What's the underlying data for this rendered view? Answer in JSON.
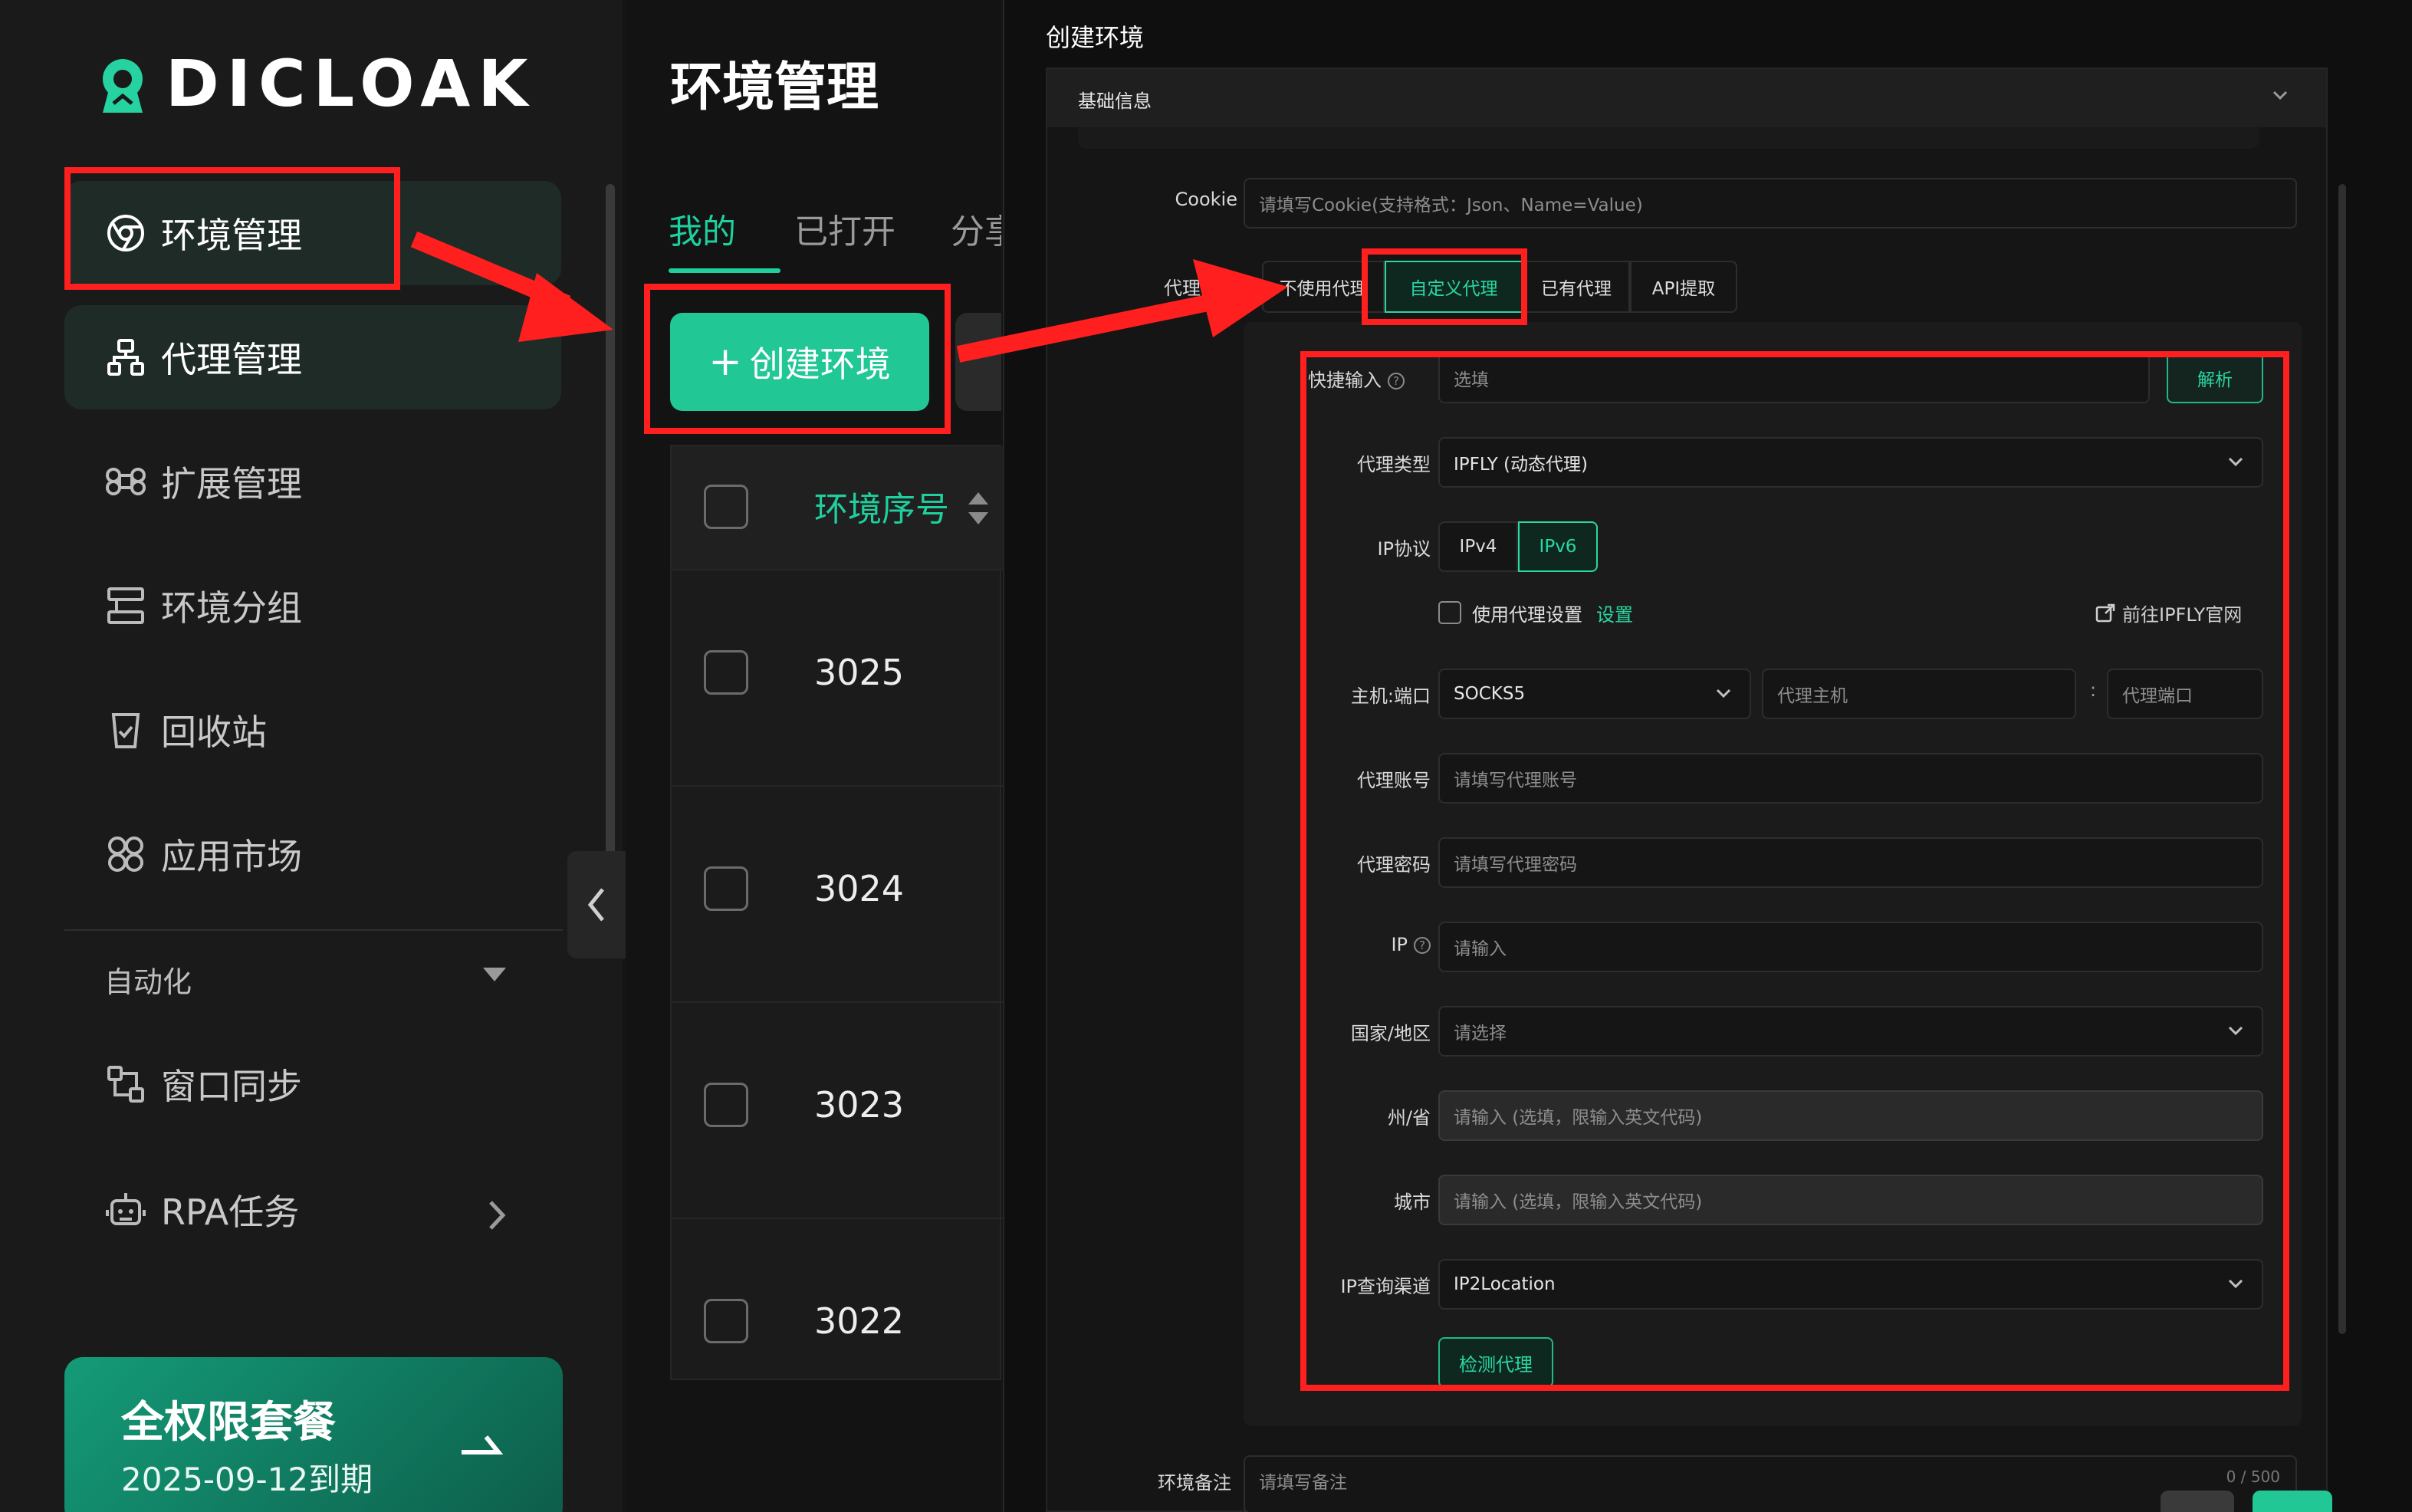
{
  "brand": {
    "name": "DICLOAK",
    "accent": "#1fcf9d",
    "highlight": "#ff1f1f"
  },
  "sidebar": {
    "items": [
      {
        "label": "环境管理",
        "icon": "chrome-icon",
        "active": true
      },
      {
        "label": "代理管理",
        "icon": "proxy-icon",
        "active": false
      },
      {
        "label": "扩展管理",
        "icon": "command-icon",
        "active": false
      },
      {
        "label": "环境分组",
        "icon": "group-icon",
        "active": false
      },
      {
        "label": "回收站",
        "icon": "trash-icon",
        "active": false
      },
      {
        "label": "应用市场",
        "icon": "apps-icon",
        "active": false
      }
    ],
    "group_title": "自动化",
    "auto_items": [
      {
        "label": "窗口同步",
        "icon": "sync-icon"
      },
      {
        "label": "RPA任务",
        "icon": "robot-icon"
      }
    ],
    "plan": {
      "title": "全权限套餐",
      "expiry": "2025-09-12到期"
    }
  },
  "main": {
    "title": "环境管理",
    "tabs": [
      "我的",
      "已打开",
      "分享"
    ],
    "create_button": "创建环境",
    "table": {
      "header": "环境序号",
      "rows": [
        "3025",
        "3024",
        "3023",
        "3022"
      ]
    }
  },
  "panel": {
    "title": "创建环境",
    "section": "基础信息",
    "cookie": {
      "label": "Cookie",
      "placeholder": "请填写Cookie(支持格式：Json、Name=Value)"
    },
    "proxy_setting": {
      "label": "代理设置",
      "options": [
        "不使用代理",
        "自定义代理",
        "已有代理",
        "API提取"
      ],
      "active": "自定义代理"
    },
    "quick_input": {
      "label": "快捷输入",
      "placeholder": "选填",
      "parse": "解析"
    },
    "proxy_type": {
      "label": "代理类型",
      "value": "IPFLY (动态代理)"
    },
    "ip_protocol": {
      "label": "IP协议",
      "options": [
        "IPv4",
        "IPv6"
      ],
      "active": "IPv6"
    },
    "use_proxy": {
      "label": "使用代理设置",
      "link": "设置",
      "external": "前往IPFLY官网"
    },
    "host_port": {
      "label": "主机:端口",
      "protocol": "SOCKS5",
      "host_placeholder": "代理主机",
      "sep": ":",
      "port_placeholder": "代理端口"
    },
    "account": {
      "label": "代理账号",
      "placeholder": "请填写代理账号"
    },
    "password": {
      "label": "代理密码",
      "placeholder": "请填写代理密码"
    },
    "ip": {
      "label": "IP",
      "placeholder": "请输入"
    },
    "country": {
      "label": "国家/地区",
      "placeholder": "请选择"
    },
    "state": {
      "label": "州/省",
      "placeholder": "请输入 (选填，限输入英文代码)"
    },
    "city": {
      "label": "城市",
      "placeholder": "请输入 (选填，限输入英文代码)"
    },
    "ip_channel": {
      "label": "IP查询渠道",
      "value": "IP2Location"
    },
    "detect_button": "检测代理",
    "note": {
      "label": "环境备注",
      "placeholder": "请填写备注",
      "counter": "0 / 500"
    }
  }
}
